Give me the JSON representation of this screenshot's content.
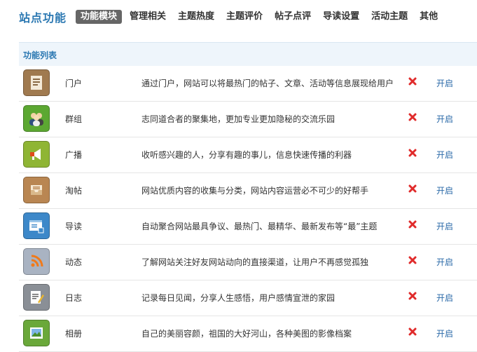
{
  "header": {
    "title": "站点功能",
    "tabs": [
      "功能模块",
      "管理相关",
      "主题热度",
      "主题评价",
      "帖子点评",
      "导读设置",
      "活动主题",
      "其他"
    ]
  },
  "list": {
    "title": "功能列表",
    "action_label": "开启",
    "items": [
      {
        "name": "门户",
        "desc": "通过门户，网站可以将最热门的帖子、文章、活动等信息展现给用户",
        "icon": "portal-icon",
        "color": "#a07a4f"
      },
      {
        "name": "群组",
        "desc": "志同道合者的聚集地，更加专业更加隐秘的交流乐园",
        "icon": "group-icon",
        "color": "#5ca832"
      },
      {
        "name": "广播",
        "desc": "收听感兴趣的人，分享有趣的事儿，信息快速传播的利器",
        "icon": "broadcast-icon",
        "color": "#8fb534"
      },
      {
        "name": "淘帖",
        "desc": "网站优质内容的收集与分类，网站内容运营必不可少的好帮手",
        "icon": "collection-icon",
        "color": "#b98652"
      },
      {
        "name": "导读",
        "desc": "自动聚合网站最具争议、最热门、最精华、最新发布等“最”主题",
        "icon": "guide-icon",
        "color": "#3d88c9"
      },
      {
        "name": "动态",
        "desc": "了解网站关注好友网站动向的直接渠道，让用户不再感觉孤独",
        "icon": "feed-icon",
        "color": "#a9b3c2"
      },
      {
        "name": "日志",
        "desc": "记录每日见闻，分享人生感悟，用户感情宣泄的家园",
        "icon": "blog-icon",
        "color": "#8a8f96"
      },
      {
        "name": "相册",
        "desc": "自己的美丽容颜，祖国的大好河山，各种美图的影像档案",
        "icon": "album-icon",
        "color": "#6aa83a"
      }
    ]
  }
}
